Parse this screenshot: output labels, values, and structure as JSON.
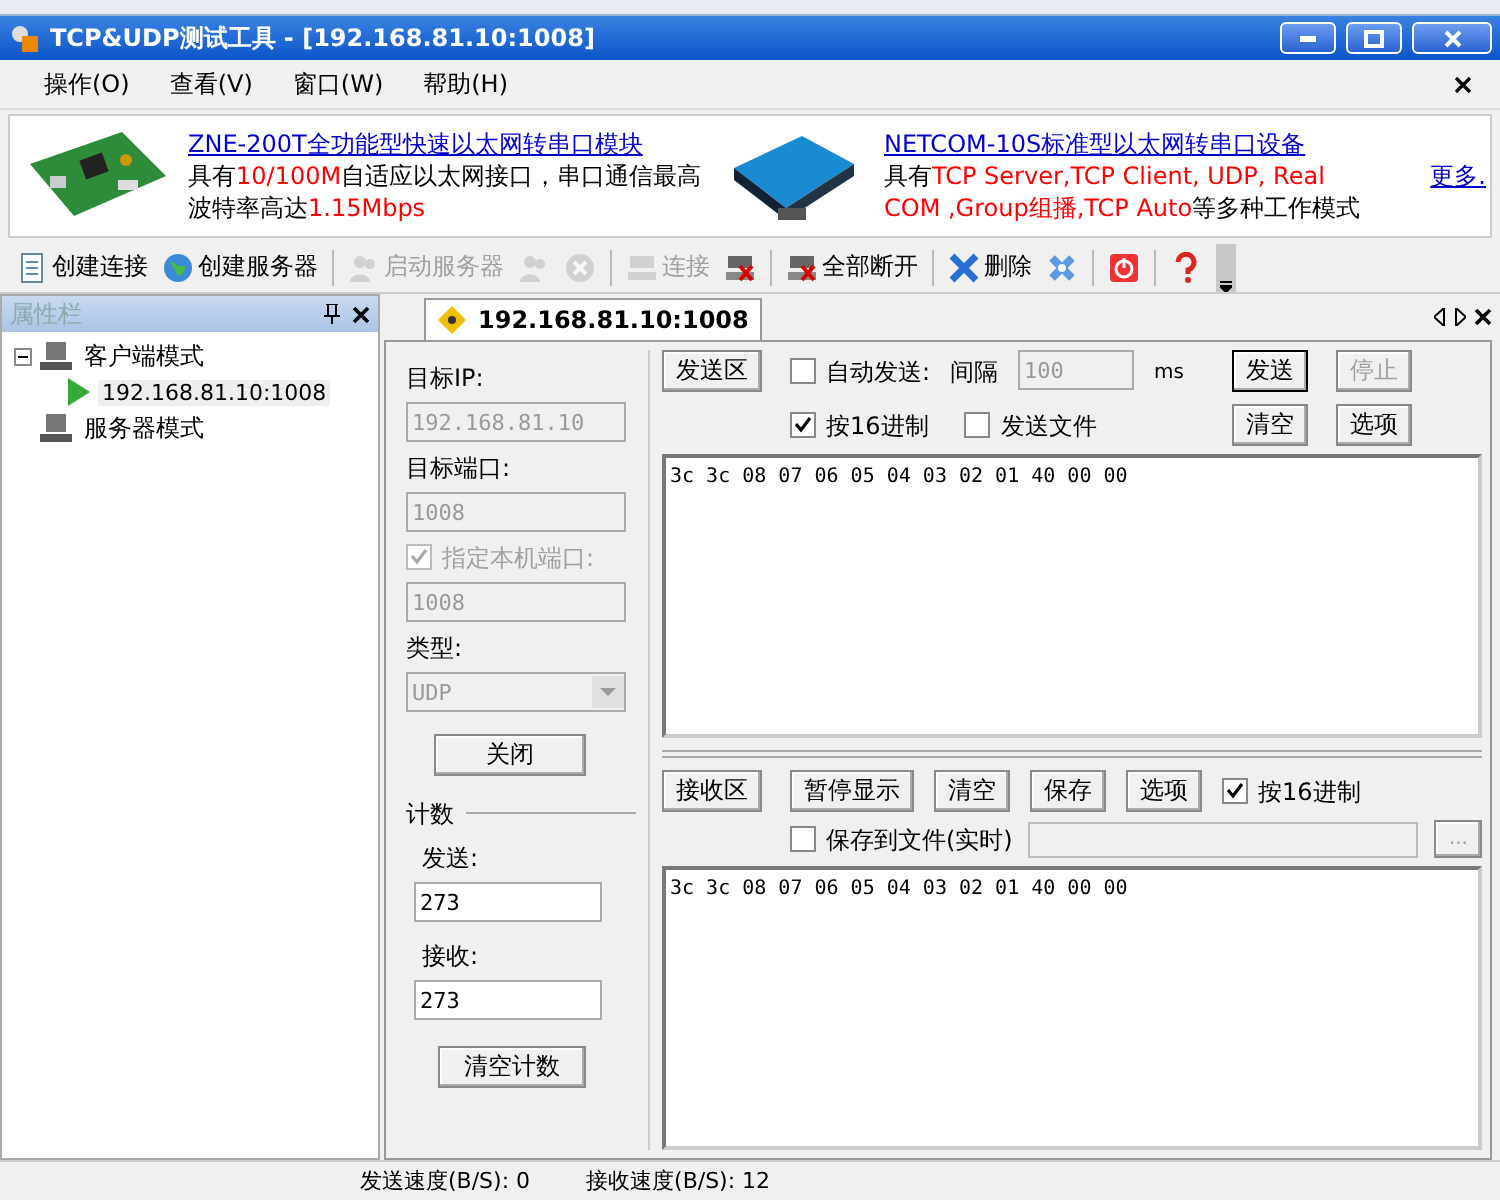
{
  "window": {
    "title": "TCP&UDP测试工具 - [192.168.81.10:1008]"
  },
  "menu": [
    "操作(O)",
    "查看(V)",
    "窗口(W)",
    "帮助(H)"
  ],
  "banner": {
    "ads": [
      {
        "title": "ZNE-200T全功能型快速以太网转串口模块",
        "lines": [
          "具有**10/100M**自适应以太网接口，串口通信最高",
          "波特率高达**1.15Mbps**"
        ]
      },
      {
        "title": "NETCOM-10S标准型以太网转串口设备",
        "lines": [
          "具有**TCP Server,TCP Client, UDP, Real**",
          "**COM ,Group组播,TCP Auto**等多种工作模式"
        ]
      }
    ],
    "more": "更多."
  },
  "toolbar": [
    {
      "kind": "button",
      "label": "创建连接",
      "disabled": false
    },
    {
      "kind": "button",
      "label": "创建服务器",
      "disabled": false
    },
    {
      "kind": "sep"
    },
    {
      "kind": "button",
      "label": "启动服务器",
      "disabled": true
    },
    {
      "kind": "button",
      "disabled": true
    },
    {
      "kind": "button",
      "disabled": true
    },
    {
      "kind": "sep"
    },
    {
      "kind": "button",
      "label": "连接",
      "disabled": true
    },
    {
      "kind": "button",
      "disabled": false
    },
    {
      "kind": "sep"
    },
    {
      "kind": "button",
      "label": "全部断开",
      "disabled": false
    },
    {
      "kind": "sep"
    },
    {
      "kind": "button",
      "label": "删除",
      "disabled": false
    },
    {
      "kind": "button",
      "disabled": false
    },
    {
      "kind": "sep"
    },
    {
      "kind": "button",
      "disabled": false
    },
    {
      "kind": "sep"
    },
    {
      "kind": "button",
      "disabled": false
    }
  ],
  "sidebar": {
    "title": "属性栏",
    "tree": [
      {
        "label": "客户端模式",
        "expanded": true,
        "children": [
          {
            "label": "192.168.81.10:1008",
            "selected": true
          }
        ]
      },
      {
        "label": "服务器模式"
      }
    ]
  },
  "tab": {
    "label": "192.168.81.10:1008",
    "selected": true
  },
  "settings": {
    "target_ip": {
      "label": "目标IP:",
      "value": "192.168.81.10",
      "disabled": true
    },
    "target_port": {
      "label": "目标端口:",
      "value": "1008",
      "disabled": true
    },
    "local_port": {
      "label": "指定本机端口:",
      "checked": true,
      "disabled": true,
      "value": "1008"
    },
    "type": {
      "label": "类型:",
      "value": "UDP",
      "disabled": true
    },
    "close_button": "关闭",
    "count": {
      "title": "计数",
      "send_label": "发送:",
      "send_value": "273",
      "recv_label": "接收:",
      "recv_value": "273",
      "clear_button": "清空计数"
    }
  },
  "send_area": {
    "title_button": "发送区",
    "auto_send": {
      "label": "自动发送:",
      "checked": false
    },
    "interval_label": "间隔",
    "interval_value": "100",
    "unit": "ms",
    "send_button": {
      "label": "发送",
      "disabled": false
    },
    "stop_button": {
      "label": "停止",
      "disabled": true
    },
    "hex": {
      "label": "按16进制",
      "checked": true
    },
    "send_file": {
      "label": "发送文件",
      "checked": false
    },
    "clear_button": "清空",
    "options_button": "选项",
    "content": "3c 3c 08 07 06 05 04 03 02 01 40 00 00"
  },
  "receive_area": {
    "title_button": "接收区",
    "buttons": [
      "暂停显示",
      "清空",
      "保存",
      "选项"
    ],
    "hex": {
      "label": "按16进制",
      "checked": true
    },
    "save_to_file": {
      "label": "保存到文件(实时)",
      "checked": false
    },
    "browse_button": "...",
    "content": "3c 3c 08 07 06 05 04 03 02 01 40 00 00"
  },
  "status_bar": {
    "send_speed": "发送速度(B/S): 0",
    "recv_speed": "接收速度(B/S): 12"
  }
}
